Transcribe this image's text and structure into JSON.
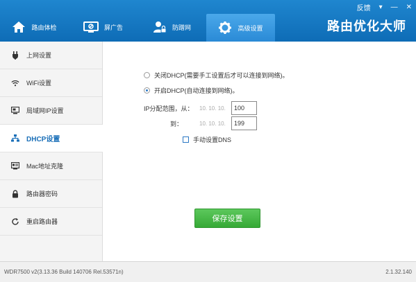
{
  "window": {
    "feedback_link": "反馈",
    "menu_glyph": "▾",
    "min_glyph": "—",
    "close_glyph": "✕"
  },
  "nav": {
    "tabs": [
      {
        "label": "路由体检",
        "icon": "house-icon"
      },
      {
        "label": "屏广告",
        "icon": "monitor-icon"
      },
      {
        "label": "防蹭网",
        "icon": "user-lock-icon"
      },
      {
        "label": "高级设置",
        "icon": "gear-icon"
      }
    ],
    "active_tab": 3,
    "brand": "路由优化大师"
  },
  "sidebar": {
    "items": [
      {
        "label": "上网设置",
        "icon": "plug-icon"
      },
      {
        "label": "WiFi设置",
        "icon": "wifi-icon"
      },
      {
        "label": "局域网IP设置",
        "icon": "lan-monitor-icon"
      },
      {
        "label": "DHCP设置",
        "icon": "network-tree-icon"
      },
      {
        "label": "Mac地址克隆",
        "icon": "mac-card-icon"
      },
      {
        "label": "路由器密码",
        "icon": "lock-icon"
      },
      {
        "label": "重启路由器",
        "icon": "restart-icon"
      }
    ],
    "active_index": 3
  },
  "dhcp": {
    "option_off": "关闭DHCP(需要手工设置后才可以连接到网络)。",
    "option_on": "开启DHCP(自动连接到网络)。",
    "selected": "on",
    "range_label_from": "IP分配范围，从：",
    "range_label_to": "到：",
    "ip_prefix": "10. 10. 10.",
    "range_start": "100",
    "range_end": "199",
    "manual_dns_label": "手动设置DNS",
    "manual_dns_checked": false,
    "save_button": "保存设置"
  },
  "footer": {
    "firmware": "WDR7500 v2(3.13.36 Build 140706 Rel.53571n)",
    "version": "2.1.32.140"
  },
  "colors": {
    "header": "#1577c3",
    "active_tab": "#3d9ee5",
    "save_button": "#44b544",
    "active_sidebar_text": "#1a6fb8"
  }
}
